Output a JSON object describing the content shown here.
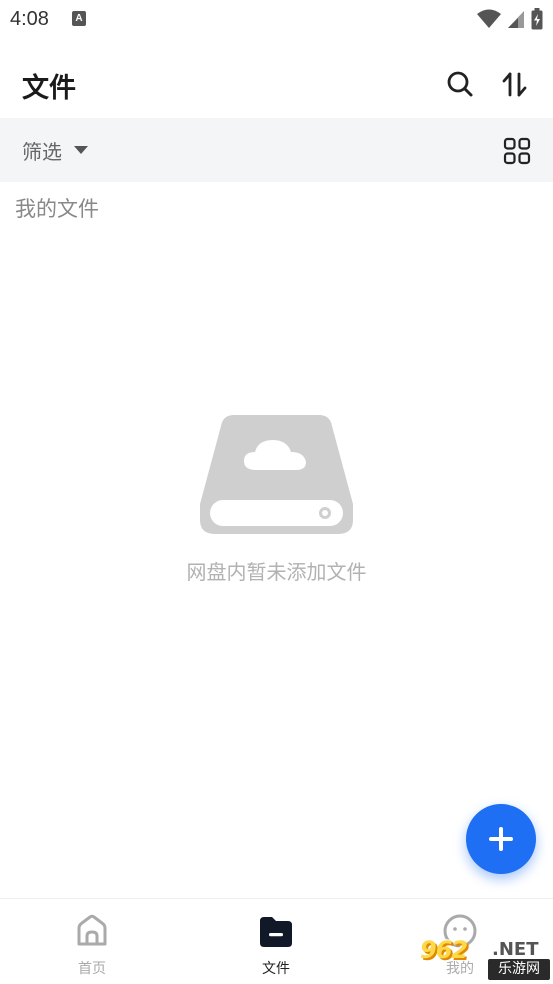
{
  "status_bar": {
    "time": "4:08",
    "notification_icon": "A"
  },
  "header": {
    "title": "文件",
    "search_icon": "search-icon",
    "sort_icon": "sort-icon"
  },
  "filter_bar": {
    "filter_label": "筛选",
    "view_icon": "grid-view-icon"
  },
  "section": {
    "title": "我的文件"
  },
  "empty_state": {
    "message": "网盘内暂未添加文件",
    "illustration_icon": "cloud-drive-icon"
  },
  "fab": {
    "icon": "plus-icon"
  },
  "bottom_nav": {
    "items": [
      {
        "label": "首页",
        "icon": "home-icon",
        "active": false
      },
      {
        "label": "文件",
        "icon": "folder-icon",
        "active": true
      },
      {
        "label": "我的",
        "icon": "profile-icon",
        "active": false
      }
    ]
  },
  "watermark": {
    "number": "962",
    "suffix": ".NET",
    "caption": "乐游网"
  },
  "colors": {
    "accent": "#1e6ff3",
    "filter_bg": "#f4f5f7",
    "muted_text": "#b2b2b2"
  }
}
